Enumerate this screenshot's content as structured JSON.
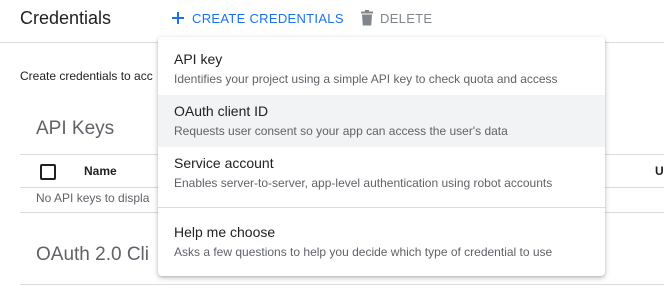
{
  "header": {
    "title": "Credentials",
    "create_label": "CREATE CREDENTIALS",
    "delete_label": "DELETE"
  },
  "main": {
    "intro": "Create credentials to acc",
    "api_keys": {
      "title": "API Keys",
      "columns": [
        "Name",
        "U"
      ],
      "empty": "No API keys to displa"
    },
    "oauth": {
      "title": "OAuth 2.0 Cli"
    }
  },
  "menu": {
    "items": [
      {
        "title": "API key",
        "description": "Identifies your project using a simple API key to check quota and access"
      },
      {
        "title": "OAuth client ID",
        "description": "Requests user consent so your app can access the user's data"
      },
      {
        "title": "Service account",
        "description": "Enables server-to-server, app-level authentication using robot accounts"
      },
      {
        "title": "Help me choose",
        "description": "Asks a few questions to help you decide which type of credential to use"
      }
    ],
    "highlighted_index": 1
  },
  "colors": {
    "accent": "#1a73e8",
    "disabled": "#80868b",
    "highlight": "#f1f3f4",
    "divider": "#dadce0"
  },
  "icons": {
    "create": "plus-icon",
    "delete": "trash-icon"
  }
}
